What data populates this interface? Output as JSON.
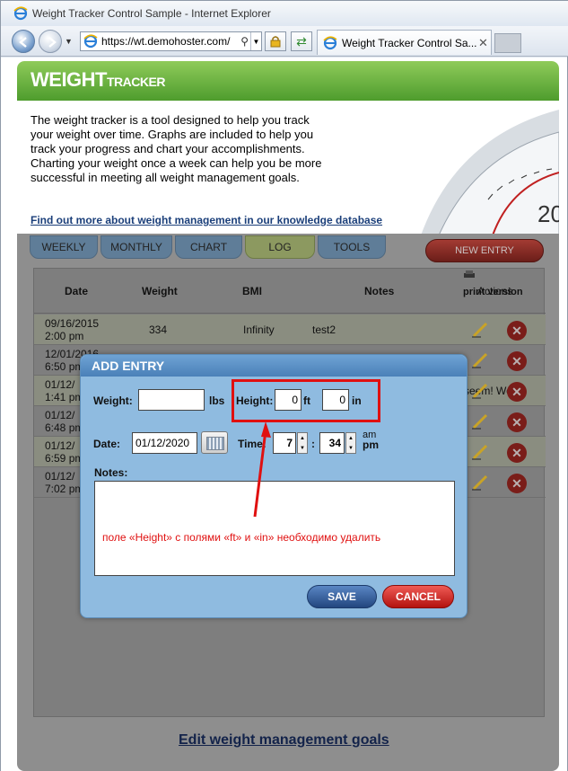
{
  "window": {
    "title": "Weight Tracker Control Sample - Internet Explorer"
  },
  "browser": {
    "url": "https://wt.demohoster.com/",
    "tab_label": "Weight Tracker Control Sa...",
    "search_glyph": "⚲",
    "tab_close": "✕"
  },
  "header": {
    "logo_main": "WEIGHT",
    "logo_sub": "TRACKER",
    "intro": "The weight tracker is a tool designed to help you track your weight over time. Graphs are included to help you track your progress and chart your accomplishments. Charting your weight once a week can help you be more successful in meeting all weight management goals.",
    "kb_link": "Find out more about weight management in our knowledge database"
  },
  "nav": {
    "tabs": [
      "WEEKLY",
      "MONTHLY",
      "CHART",
      "LOG",
      "TOOLS"
    ],
    "active_tab": "LOG",
    "new_entry": "NEW ENTRY"
  },
  "log": {
    "print_version": "print version",
    "columns": {
      "date": "Date",
      "weight": "Weight",
      "bmi": "BMI",
      "notes": "Notes",
      "actions": "Actions"
    },
    "rows": [
      {
        "date": "09/16/2015",
        "time": "2:00 pm",
        "weight": "334",
        "bmi": "Infinity",
        "notes": "test2"
      },
      {
        "date": "12/01/2016",
        "time": "6:50 pm",
        "weight": "",
        "bmi": "",
        "notes": ""
      },
      {
        "date": "01/12/",
        "time": "1:41 pm",
        "weight": "",
        "bmi": "",
        "notes": "er seem! We"
      },
      {
        "date": "01/12/",
        "time": "6:48 pm",
        "weight": "",
        "bmi": "",
        "notes": ""
      },
      {
        "date": "01/12/",
        "time": "6:59 pm",
        "weight": "",
        "bmi": "",
        "notes": ""
      },
      {
        "date": "01/12/",
        "time": "7:02 pm",
        "weight": "",
        "bmi": "",
        "notes": ""
      }
    ],
    "goals_link": "Edit weight management goals"
  },
  "modal": {
    "title": "ADD ENTRY",
    "weight_label": "Weight:",
    "weight_value": "",
    "weight_unit": "lbs",
    "height_label": "Height:",
    "height_ft": "0",
    "ft_unit": "ft",
    "height_in": "0",
    "in_unit": "in",
    "date_label": "Date:",
    "date_value": "01/12/2020",
    "time_label": "Time:",
    "hour": "7",
    "minute": "34",
    "time_sep": ":",
    "am": "am",
    "pm": "pm",
    "notes_label": "Notes:",
    "save": "SAVE",
    "cancel": "CANCEL"
  },
  "annotation": {
    "text": "поле «Height» с полями «ft» и «in» необходимо удалить",
    "color": "#e01010"
  }
}
